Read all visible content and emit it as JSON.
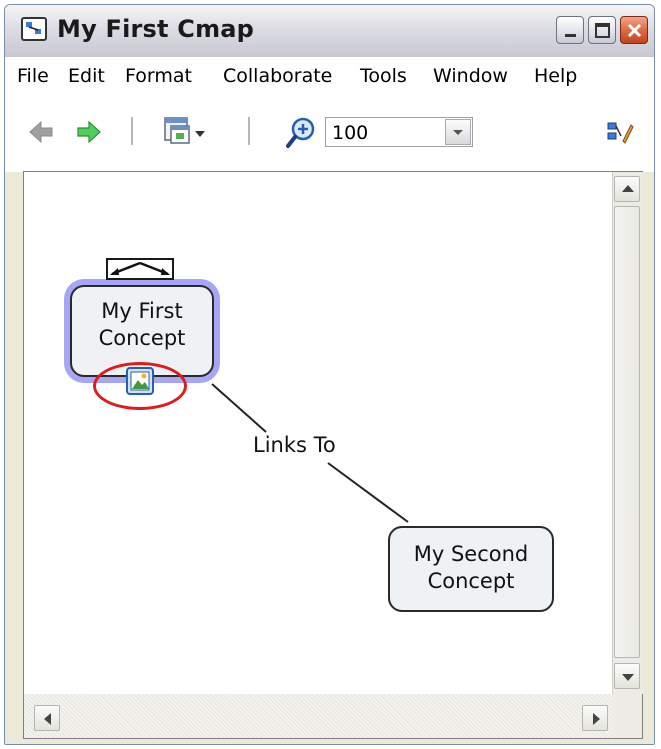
{
  "window": {
    "title": "My First Cmap"
  },
  "menu": {
    "items": [
      "File",
      "Edit",
      "Format",
      "Collaborate",
      "Tools",
      "Window",
      "Help"
    ]
  },
  "toolbar": {
    "back_icon": "back-arrow-icon",
    "forward_icon": "forward-arrow-icon",
    "view_icon": "view-menu-icon",
    "zoom_icon": "zoom-in-icon",
    "zoom_value": "100",
    "tools_icon": "cmap-tools-icon"
  },
  "map": {
    "concepts": [
      {
        "label_line1": "My First",
        "label_line2": "Concept"
      },
      {
        "label_line1": "My Second",
        "label_line2": "Concept"
      }
    ],
    "link_label": "Links To"
  },
  "colors": {
    "selection_halo": "#a7a6f6",
    "highlight_ring": "#e01b1b",
    "forward_arrow": "#3fbf48",
    "back_arrow": "#a0a0a0"
  }
}
